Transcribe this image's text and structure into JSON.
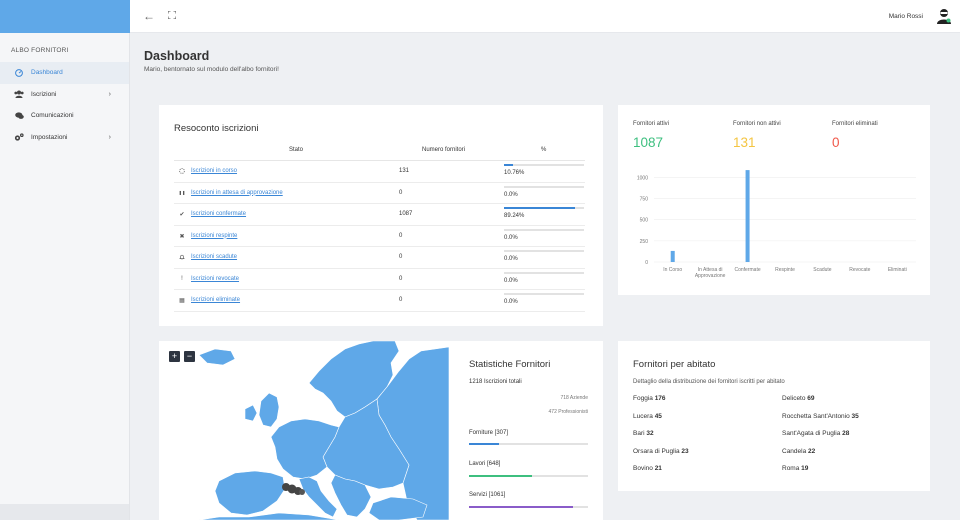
{
  "topbar": {
    "user_name": "Mario Rossi"
  },
  "sidebar": {
    "title": "ALBO FORNITORI",
    "items": [
      {
        "label": "Dashboard",
        "icon": "dashboard-icon",
        "active": true,
        "has_submenu": false
      },
      {
        "label": "Iscrizioni",
        "icon": "users-icon",
        "active": false,
        "has_submenu": true
      },
      {
        "label": "Comunicazioni",
        "icon": "comments-icon",
        "active": false,
        "has_submenu": false
      },
      {
        "label": "Impostazioni",
        "icon": "gears-icon",
        "active": false,
        "has_submenu": true
      }
    ]
  },
  "header": {
    "title": "Dashboard",
    "subtitle": "Mario, bentornato sul modulo dell'albo fornitori!"
  },
  "resoconto": {
    "title": "Resoconto iscrizioni",
    "columns": [
      "Stato",
      "Numero fornitori",
      "%"
    ],
    "rows": [
      {
        "label": "Iscrizioni in corso",
        "icon": "spinner-icon",
        "count": "131",
        "pct": "10.76%",
        "fill": 10.76
      },
      {
        "label": "Iscrizioni in attesa di approvazione",
        "icon": "pause-icon",
        "count": "0",
        "pct": "0.0%",
        "fill": 0
      },
      {
        "label": "Iscrizioni confermate",
        "icon": "check-icon",
        "count": "1087",
        "pct": "89.24%",
        "fill": 89.24
      },
      {
        "label": "Iscrizioni respinte",
        "icon": "times-icon",
        "count": "0",
        "pct": "0.0%",
        "fill": 0
      },
      {
        "label": "Iscrizioni scadute",
        "icon": "bell-icon",
        "count": "0",
        "pct": "0.0%",
        "fill": 0
      },
      {
        "label": "Iscrizioni revocate",
        "icon": "exclamation-icon",
        "count": "0",
        "pct": "0.0%",
        "fill": 0
      },
      {
        "label": "Iscrizioni eliminate",
        "icon": "trash-icon",
        "count": "0",
        "pct": "0.0%",
        "fill": 0
      }
    ]
  },
  "counts": [
    {
      "label": "Fornitori attivi",
      "value": "1087",
      "color": "#3dbf7f"
    },
    {
      "label": "Fornitori non attivi",
      "value": "131",
      "color": "#f4c542"
    },
    {
      "label": "Fornitori eliminati",
      "value": "0",
      "color": "#f0584a"
    }
  ],
  "chart_data": {
    "type": "bar",
    "categories": [
      "In Corso",
      "In Attesa di Approvazione",
      "Confermate",
      "Respinte",
      "Scadute",
      "Revocate",
      "Eliminati"
    ],
    "category_lines": [
      [
        "In Corso"
      ],
      [
        "In Attesa di",
        "Approvazione"
      ],
      [
        "Confermate"
      ],
      [
        "Respinte"
      ],
      [
        "Scadute"
      ],
      [
        "Revocate"
      ],
      [
        "Eliminati"
      ]
    ],
    "values": [
      131,
      0,
      1087,
      0,
      0,
      0,
      0
    ],
    "yticks": [
      0,
      250,
      500,
      750,
      1000
    ],
    "ytick_labels": [
      "0",
      "250",
      "500",
      "750",
      "1000"
    ],
    "ylim": [
      0,
      1100
    ],
    "color": "#5fa8e8"
  },
  "stats": {
    "title": "Statistiche Fornitori",
    "total": "1218 Iscrizioni totali",
    "aziende": "718 Aziende",
    "professionisti": "472 Professionisti",
    "items": [
      {
        "label": "Forniture [307]",
        "fill": 25.2,
        "color": "#3a86d6"
      },
      {
        "label": "Lavori [648]",
        "fill": 53.2,
        "color": "#3dbf7f"
      },
      {
        "label": "Servizi [1061]",
        "fill": 87.1,
        "color": "#8a5cc9"
      }
    ]
  },
  "map": {
    "zoom_in": "+",
    "zoom_out": "−",
    "land_color": "#5fa8e8"
  },
  "abitato": {
    "title": "Fornitori per abitato",
    "subtitle": "Dettaglio della distribuzione dei fornitori iscritti per abitato",
    "items": [
      {
        "name": "Foggia",
        "count": "176"
      },
      {
        "name": "Deliceto",
        "count": "69"
      },
      {
        "name": "Lucera",
        "count": "45"
      },
      {
        "name": "Rocchetta Sant'Antonio",
        "count": "35"
      },
      {
        "name": "Bari",
        "count": "32"
      },
      {
        "name": "Sant'Agata di Puglia",
        "count": "28"
      },
      {
        "name": "Orsara di Puglia",
        "count": "23"
      },
      {
        "name": "Candela",
        "count": "22"
      },
      {
        "name": "Bovino",
        "count": "21"
      },
      {
        "name": "Roma",
        "count": "19"
      }
    ]
  }
}
